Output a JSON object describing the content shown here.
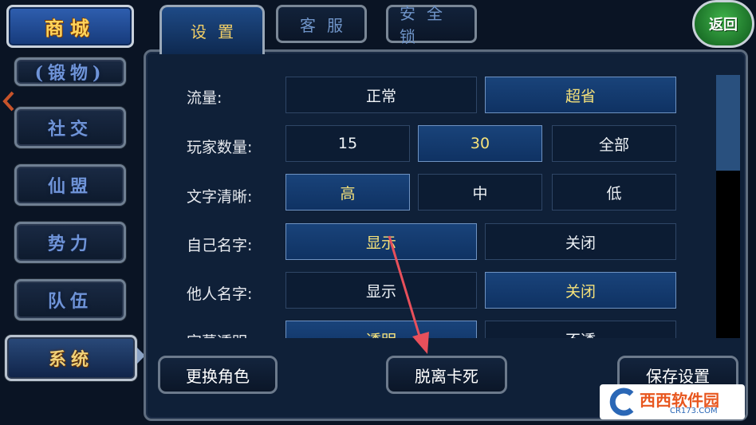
{
  "sidebar": {
    "shop_label": "商城",
    "items": [
      {
        "label": "(锻物)"
      },
      {
        "label": "社交"
      },
      {
        "label": "仙盟"
      },
      {
        "label": "势力"
      },
      {
        "label": "队伍"
      },
      {
        "label": "系统",
        "active": true
      }
    ]
  },
  "tabs": [
    {
      "label": "设置",
      "active": true
    },
    {
      "label": "客服"
    },
    {
      "label": "安全锁"
    }
  ],
  "back_label": "返回",
  "settings": {
    "rows": [
      {
        "label": "流量:",
        "options": [
          "正常",
          "超省"
        ],
        "selected": 1
      },
      {
        "label": "玩家数量:",
        "options": [
          "15",
          "30",
          "全部"
        ],
        "selected": 1
      },
      {
        "label": "文字清晰:",
        "options": [
          "高",
          "中",
          "低"
        ],
        "selected": 0
      },
      {
        "label": "自己名字:",
        "options": [
          "显示",
          "关闭"
        ],
        "selected": 0
      },
      {
        "label": "他人名字:",
        "options": [
          "显示",
          "关闭"
        ],
        "selected": 1
      },
      {
        "label": "字幕透明:",
        "options": [
          "透明",
          "不透"
        ],
        "selected": 0
      }
    ]
  },
  "bottom": {
    "change_role": "更换角色",
    "unstuck": "脱离卡死",
    "save": "保存设置"
  },
  "watermark": {
    "brand": "西西软件园",
    "site": "CR173.COM"
  },
  "colors": {
    "selected_text": "#f6e27a",
    "accent": "#f2cf66",
    "arrow": "#e8505b"
  }
}
